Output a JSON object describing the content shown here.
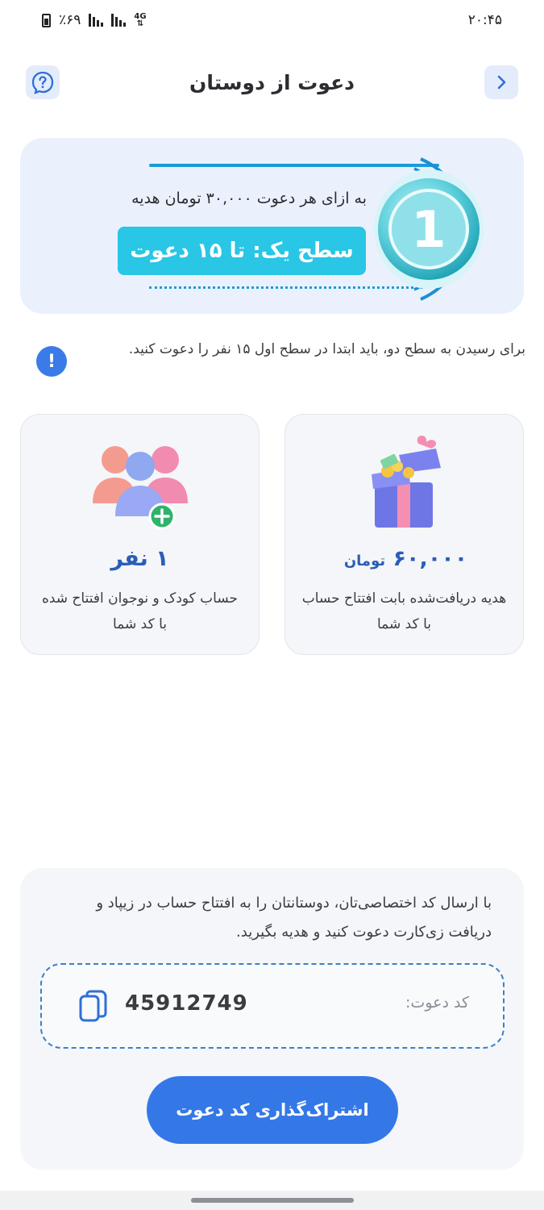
{
  "status_bar": {
    "time": "۲۰:۴۵",
    "battery": "٪۶۹",
    "network": "4G"
  },
  "header": {
    "title": "دعوت از دوستان"
  },
  "level_card": {
    "reward_text": "به ازای هر دعوت ۳۰,۰۰۰ تومان هدیه",
    "level_label": "سطح یک: تا ۱۵ دعوت",
    "badge_number": "1"
  },
  "info": {
    "text": "برای رسیدن به سطح دو، باید ابتدا در سطح اول ۱۵ نفر را دعوت کنید."
  },
  "stats": {
    "gift": {
      "value": "۶۰,۰۰۰",
      "unit": "تومان",
      "description": "هدیه دریافت‌شده بابت افتتاح حساب با کد شما"
    },
    "accounts": {
      "value": "۱ نفر",
      "description": "حساب کودک و نوجوان افتتاح شده با کد شما"
    }
  },
  "invite": {
    "description": "با ارسال کد اختصاصی‌تان، دوستانتان را به افتتاح حساب در زیپاد و دریافت زی‌کارت دعوت کنید و هدیه بگیرید.",
    "code_label": "کد دعوت:",
    "code_value": "45912749",
    "share_label": "اشتراک‌گذاری کد دعوت"
  },
  "colors": {
    "accent": "#3478e8",
    "cyan": "#29c6e6",
    "card_bg": "#eaf1fc",
    "stat_value": "#2a5eb7"
  }
}
